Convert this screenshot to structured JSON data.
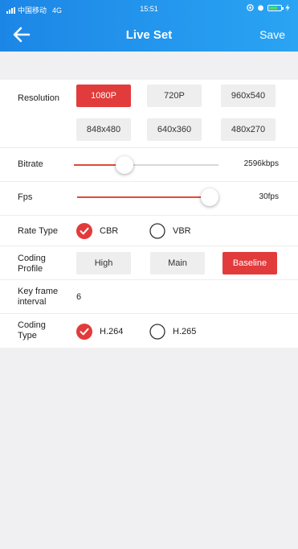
{
  "status_bar": {
    "carrier": "中国移动",
    "network": "4G",
    "time": "15:51"
  },
  "header": {
    "title": "Live Set",
    "save_label": "Save",
    "back_icon": "arrow-left-icon"
  },
  "resolution": {
    "label": "Resolution",
    "options": [
      "1080P",
      "720P",
      "960x540",
      "848x480",
      "640x360",
      "480x270"
    ],
    "selected": "1080P"
  },
  "bitrate": {
    "label": "Bitrate",
    "value_text": "2596kbps",
    "level": 0.35
  },
  "fps": {
    "label": "Fps",
    "value_text": "30fps",
    "level": 1.0
  },
  "rate_type": {
    "label": "Rate Type",
    "options": [
      "CBR",
      "VBR"
    ],
    "selected": "CBR"
  },
  "coding_profile": {
    "label_line1": "Coding",
    "label_line2": "Profile",
    "options": [
      "High",
      "Main",
      "Baseline"
    ],
    "selected": "Baseline"
  },
  "key_frame": {
    "label_line1": "Key frame",
    "label_line2": "interval",
    "value": "6"
  },
  "coding_type": {
    "label_line1": "Coding",
    "label_line2": "Type",
    "options": [
      "H.264",
      "H.265"
    ],
    "selected": "H.264"
  },
  "colors": {
    "header_blue": "#1c86e6",
    "accent_red": "#e23b3b",
    "background": "#f0f0f2"
  }
}
